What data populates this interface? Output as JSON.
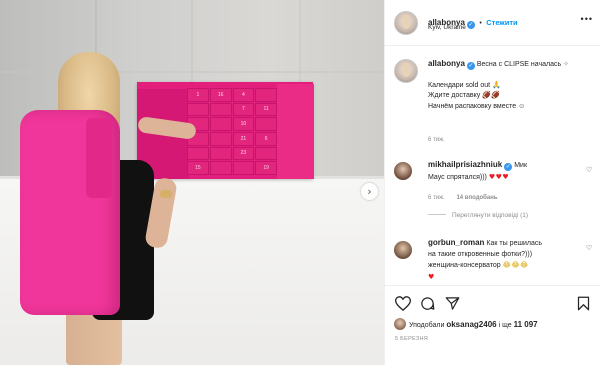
{
  "post": {
    "calendar_numbers": [
      "1",
      "16",
      "4",
      "",
      "",
      "",
      "7",
      "11",
      "",
      "",
      "10",
      "",
      "",
      "",
      "21",
      "6",
      "",
      "",
      "23",
      "",
      "15",
      "",
      "",
      "19"
    ]
  },
  "header": {
    "username": "allabonya",
    "separator": "•",
    "follow_label": "Стежити",
    "location": "Kyiv, Ukraine",
    "more_label": "•••"
  },
  "caption": {
    "username": "allabonya",
    "first_line": "Весна с CLIPSE началась",
    "lines": [
      "Календари sold out",
      "Ждите доставку",
      "Начнём распаковку вместе"
    ],
    "emojis": [
      "🙏",
      "🏈🏈",
      "☺"
    ],
    "time": "6 тиж."
  },
  "comments": [
    {
      "username": "mikhailprisiazhniuk",
      "text": "Мик",
      "text2": "Маус спрятался)))",
      "hearts": "♥♥♥",
      "time": "6 тиж.",
      "likes": "14 вподобань",
      "view_replies": "Переглянути відповіді (1)"
    },
    {
      "username": "gorbun_roman",
      "text1": "Как ты решилась",
      "text2": "на такие откровенные фотки?)))",
      "text3": "женщина-консерватор",
      "emoji": "😂😂😂",
      "heart": "♥"
    }
  ],
  "likes": {
    "prefix": "Уподобали",
    "user": "oksanag2406",
    "middle": "і ще",
    "count": "11 097"
  },
  "date": "5 БЕРЕЗНЯ",
  "colors": {
    "accent_blue": "#0095f6",
    "verified_blue": "#3897f0",
    "heart_red": "#ed1c24",
    "pink_box": "#e21f7d"
  },
  "icons": [
    "heart-icon",
    "comment-icon",
    "share-icon",
    "bookmark-icon",
    "chevron-right-icon",
    "verified-icon"
  ]
}
